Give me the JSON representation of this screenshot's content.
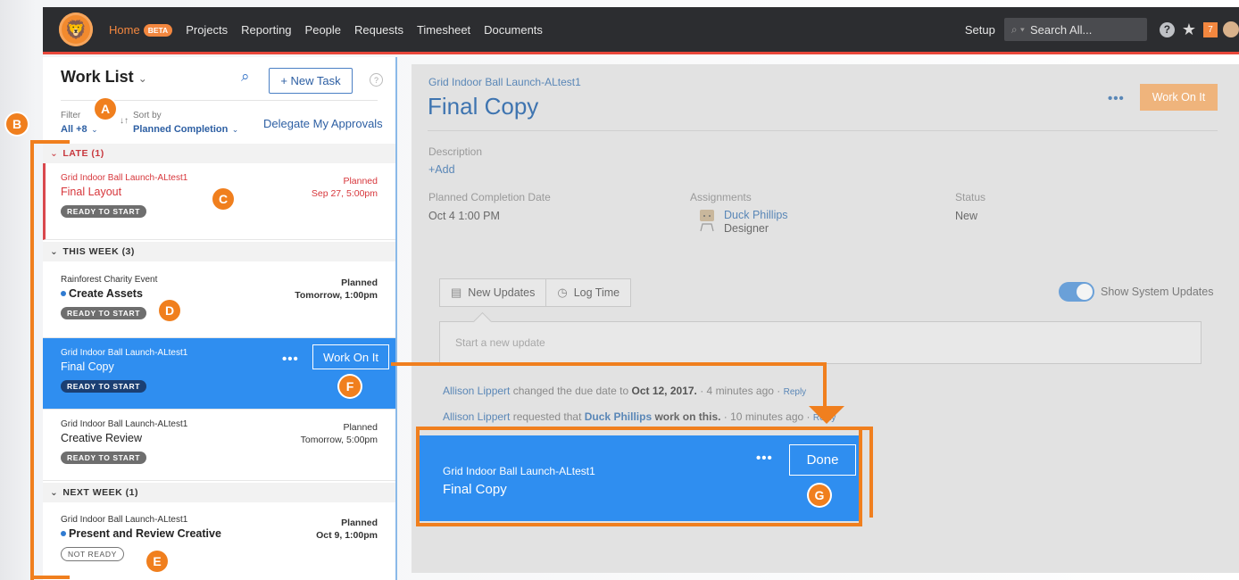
{
  "nav": {
    "items": [
      "Home",
      "Projects",
      "Reporting",
      "People",
      "Requests",
      "Timesheet",
      "Documents"
    ],
    "beta": "BETA",
    "setup": "Setup",
    "search_placeholder": "Search All...",
    "help": "?",
    "notification_count": "7"
  },
  "worklist": {
    "title": "Work List",
    "new_task": "+ New Task",
    "help": "?",
    "filter_label": "Filter",
    "filter_value": "All +8",
    "sort_label": "Sort by",
    "sort_value": "Planned Completion",
    "delegate": "Delegate My Approvals",
    "groups": [
      {
        "label": "LATE (1)"
      },
      {
        "label": "THIS WEEK (3)"
      },
      {
        "label": "NEXT WEEK (1)"
      }
    ],
    "tasks": [
      {
        "project": "Grid Indoor Ball Launch-ALtest1",
        "name": "Final Layout",
        "meta_label": "Planned",
        "meta_value": "Sep 27, 5:00pm",
        "status": "READY TO START"
      },
      {
        "project": "Rainforest Charity Event",
        "name": "Create Assets",
        "meta_label": "Planned",
        "meta_value": "Tomorrow, 1:00pm",
        "status": "READY TO START"
      },
      {
        "project": "Grid Indoor Ball Launch-ALtest1",
        "name": "Final Copy",
        "status": "READY TO START",
        "action": "Work On It"
      },
      {
        "project": "Grid Indoor Ball Launch-ALtest1",
        "name": "Creative Review",
        "meta_label": "Planned",
        "meta_value": "Tomorrow, 5:00pm",
        "status": "READY TO START"
      },
      {
        "project": "Grid Indoor Ball Launch-ALtest1",
        "name": "Present and Review  Creative",
        "meta_label": "Planned",
        "meta_value": "Oct 9, 1:00pm",
        "status": "NOT READY"
      }
    ]
  },
  "detail": {
    "project": "Grid Indoor Ball Launch-ALtest1",
    "title": "Final Copy",
    "action": "Work On It",
    "description_label": "Description",
    "description_add": "+Add",
    "planned_label": "Planned Completion Date",
    "planned_value": "Oct 4 1:00 PM",
    "assignments_label": "Assignments",
    "assignee_name": "Duck Phillips",
    "assignee_role": "Designer",
    "status_label": "Status",
    "status_value": "New",
    "tab_updates": "New Updates",
    "tab_log": "Log Time",
    "toggle_label": "Show System Updates",
    "update_placeholder": "Start a new update",
    "feed": [
      {
        "who": "Allison Lippert",
        "pre": " changed the due date to ",
        "strong": "Oct 12, 2017.",
        "time": " · 4 minutes ago · ",
        "reply": "Reply"
      },
      {
        "who": "Allison Lippert",
        "pre": " requested that ",
        "strong": "Duck Phillips",
        "post": " work on this.",
        "time": " · 10 minutes ago · ",
        "reply": "Reply"
      }
    ]
  },
  "card": {
    "project": "Grid Indoor Ball Launch-ALtest1",
    "name": "Final Copy",
    "action": "Done"
  },
  "markers": [
    "A",
    "B",
    "C",
    "D",
    "E",
    "F",
    "G"
  ],
  "colors": {
    "accent": "#f07f1e",
    "selected": "#2f8ef0",
    "late": "#d7363b",
    "link": "#2d5fa3"
  }
}
